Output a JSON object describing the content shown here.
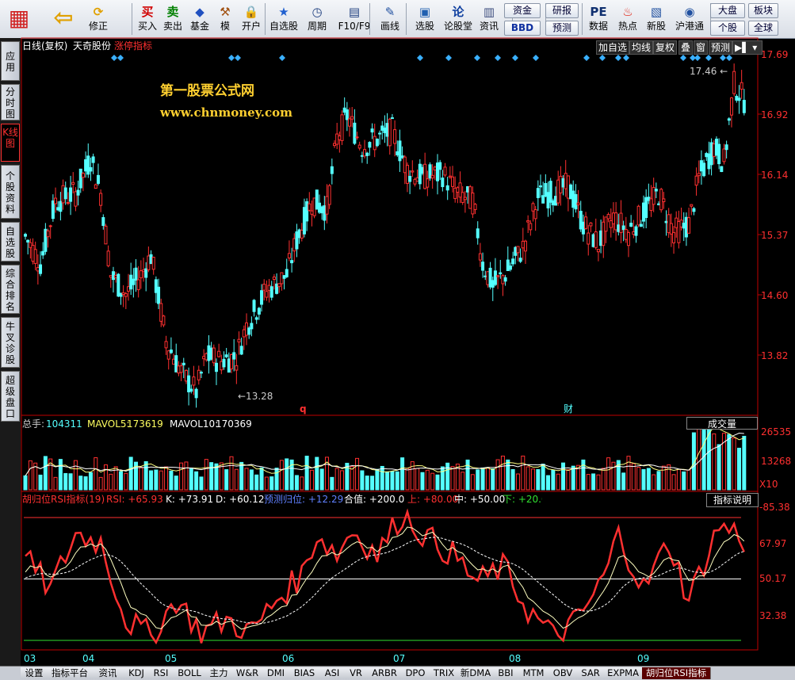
{
  "toolbar": {
    "buttons": [
      {
        "label": "",
        "icon": "grid-logo-icon"
      },
      {
        "label": "",
        "icon": "back-arrow-icon"
      },
      {
        "label": "修正",
        "icon": "refresh-icon"
      },
      {
        "label": "买入",
        "icon": "buy-icon"
      },
      {
        "label": "卖出",
        "icon": "sell-icon"
      },
      {
        "label": "基金",
        "icon": "fund-icon"
      },
      {
        "label": "模",
        "icon": "hammer-icon"
      },
      {
        "label": "开户",
        "icon": "lock-icon"
      },
      {
        "label": "自选股",
        "icon": "star-icon"
      },
      {
        "label": "周期",
        "icon": "clock-icon"
      },
      {
        "label": "F10/F9",
        "icon": "document-icon"
      },
      {
        "label": "画线",
        "icon": "pen-icon"
      },
      {
        "label": "选股",
        "icon": "screen-icon"
      },
      {
        "label": "论股堂",
        "icon": "forum-icon"
      },
      {
        "label": "资讯",
        "icon": "news-icon"
      },
      {
        "label": "数据",
        "icon": "pe-icon"
      },
      {
        "label": "热点",
        "icon": "hot-icon"
      },
      {
        "label": "新股",
        "icon": "new-stock-icon"
      },
      {
        "label": "沪港通",
        "icon": "sse-hkex-icon"
      }
    ],
    "small_buttons": [
      "资金",
      "BBD",
      "研报",
      "预测",
      "大盘",
      "个股",
      "板块",
      "全球"
    ]
  },
  "sidebar": {
    "tabs": [
      "应用",
      "分时图",
      "K线图",
      "个股资料",
      "自选股",
      "综合排名",
      "牛叉诊股",
      "超级盘口"
    ]
  },
  "header": {
    "chart_type": "日线(复权)",
    "stock_name": "天奇股份",
    "indicator_name": "涨停指标",
    "buttons": [
      "加自选",
      "均线",
      "复权",
      "叠",
      "窗",
      "预测"
    ]
  },
  "watermark": {
    "line1": "第一股票公式网",
    "line2": "www.chnmoney.com"
  },
  "price_panel": {
    "axis_labels": [
      "17.69",
      "16.92",
      "16.14",
      "15.37",
      "14.60",
      "13.82"
    ],
    "max_label": "17.46",
    "min_label": "13.28",
    "marker_q": "q",
    "marker_cai": "财"
  },
  "volume_panel": {
    "total_label": "总手:",
    "total_value": "104311",
    "mavol5_label": "MAVOL5:",
    "mavol5_value": "173619",
    "mavol10_label": "MAVOL10:",
    "mavol10_value": "170369",
    "dropdown": "成交量",
    "axis_labels": [
      "26535",
      "13268",
      "X10"
    ]
  },
  "indicator_panel": {
    "name": "胡归位RSI指标(19)",
    "rsi": "RSI: +65.93",
    "k": "K: +73.91",
    "d": "D: +60.12",
    "predict": "预测归位: +12.29",
    "sum": "合值: +200.0",
    "up": "上: +80.00",
    "mid": "中: +50.00",
    "down": "下: +20.00",
    "explain_button": "指标说明",
    "axis_labels": [
      "85.38",
      "67.97",
      "50.17",
      "32.38"
    ]
  },
  "time_axis": [
    "03",
    "04",
    "05",
    "06",
    "07",
    "08",
    "09"
  ],
  "bottom_tabs": [
    "设置",
    "指标平台",
    "资讯",
    "KDJ",
    "RSI",
    "BOLL",
    "主力",
    "W&R",
    "DMI",
    "BIAS",
    "ASI",
    "VR",
    "ARBR",
    "DPO",
    "TRIX",
    "新DMA",
    "BBI",
    "MTM",
    "OBV",
    "SAR",
    "EXPMA",
    "胡归位RSI指标"
  ],
  "colors": {
    "up": "#ff3030",
    "down": "#54ffff",
    "axis": "#c00000",
    "background": "#000000"
  }
}
